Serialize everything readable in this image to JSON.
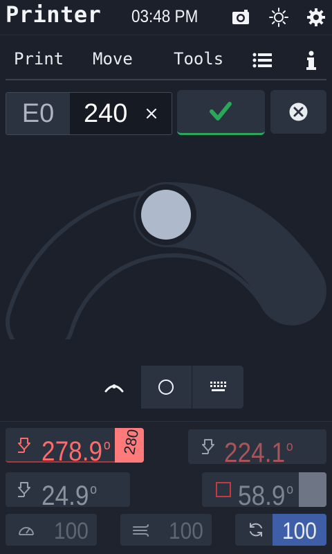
{
  "header": {
    "title": "Printer",
    "time": "03:48 PM",
    "icons": [
      "camera-icon",
      "brightness-icon",
      "settings-icon"
    ]
  },
  "nav": {
    "items": [
      {
        "label": "Print"
      },
      {
        "label": "Move"
      },
      {
        "label": "Tools"
      }
    ],
    "icons": [
      "menu-list-icon",
      "info-icon"
    ]
  },
  "numpad": {
    "tool": "E0",
    "value": "240",
    "clear": "×"
  },
  "colors": {
    "accent_ok": "#2aa85a",
    "hot": "#ff6b6b",
    "hot_dim": "#a9545a",
    "bed": "#c9383f",
    "fan_highlight": "#3e5ea8"
  },
  "modes": [
    "arc-slider-icon",
    "circle-icon",
    "keyboard-icon"
  ],
  "heaters": [
    {
      "name": "extruder",
      "temp": "278.9",
      "unit": "o",
      "target": "280",
      "active": true
    },
    {
      "name": "extruder1",
      "temp": "224.1",
      "unit": "o",
      "target": ""
    },
    {
      "name": "extruder2",
      "temp": "24.9",
      "unit": "o",
      "target": ""
    },
    {
      "name": "heater_bed",
      "temp": "58.9",
      "unit": "o",
      "target": ""
    }
  ],
  "speeds": [
    {
      "name": "speed",
      "value": "100"
    },
    {
      "name": "flow",
      "value": "100"
    },
    {
      "name": "fan",
      "value": "100"
    }
  ]
}
